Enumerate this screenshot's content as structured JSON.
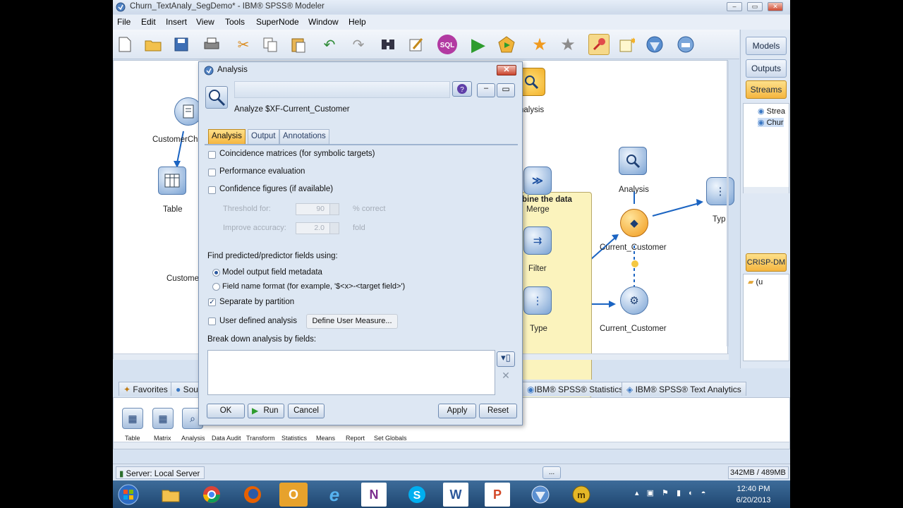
{
  "window": {
    "title": "Churn_TextAnaly_SegDemo* - IBM® SPSS® Modeler"
  },
  "menu": [
    "File",
    "Edit",
    "Insert",
    "View",
    "Tools",
    "SuperNode",
    "Window",
    "Help"
  ],
  "toolbar_icons": [
    "new-icon",
    "open-icon",
    "save-icon",
    "print-icon",
    "cut-icon",
    "copy-icon",
    "paste-icon",
    "undo-icon",
    "redo-icon",
    "find-icon",
    "edit-icon",
    "sql-icon",
    "run-icon",
    "run-selection-icon",
    "favorite-icon",
    "star-icon",
    "pin-icon",
    "annotate-icon",
    "model-icon",
    "cloud-icon"
  ],
  "toolbar_sql": "SQL",
  "right_panel": {
    "buttons": [
      "Models",
      "Outputs",
      "Streams"
    ],
    "stream_items": [
      "Strea",
      "Chur"
    ],
    "crisp": "CRISP-DM",
    "crisp_folder": "(u"
  },
  "canvas": {
    "nodes": [
      "CustomerCh",
      "Table",
      "Custome",
      "Merge",
      "Filter",
      "Type",
      "Analysis",
      "Current_Customer",
      "Current_Customer",
      "Typ",
      "nalysis"
    ],
    "supernode_label": "bine the data"
  },
  "palette_tabs": [
    "Favorites",
    "Sou",
    "IBM® SPSS® Statistics",
    "IBM® SPSS® Text Analytics"
  ],
  "palette_nodes": [
    "Table",
    "Matrix",
    "Analysis",
    "Data Audit",
    "Transform",
    "Statistics",
    "Means",
    "Report",
    "Set Globals"
  ],
  "status": {
    "server": "Server: Local Server",
    "memory": "342MB / 489MB",
    "dots": "..."
  },
  "taskbar": {
    "time": "12:40 PM",
    "date": "6/20/2013",
    "apps": [
      "windows-icon",
      "explorer-icon",
      "chrome-icon",
      "firefox-icon",
      "outlook-icon",
      "ie-icon",
      "onenote-icon",
      "skype-icon",
      "word-icon",
      "powerpoint-icon",
      "spss-icon",
      "app-icon"
    ]
  },
  "dialog": {
    "title": "Analysis",
    "subtitle": "Analyze  $XF-Current_Customer",
    "tabs": [
      "Analysis",
      "Output",
      "Annotations"
    ],
    "active_tab": "Analysis",
    "options": {
      "coincidence": "Coincidence matrices (for symbolic targets)",
      "performance": "Performance evaluation",
      "confidence": "Confidence figures (if available)",
      "threshold_label": "Threshold for:",
      "threshold_value": "90",
      "threshold_unit": "% correct",
      "improve_label": "Improve accuracy:",
      "improve_value": "2.0",
      "improve_unit": "fold",
      "find_label": "Find predicted/predictor fields using:",
      "radio_metadata": "Model output field metadata",
      "radio_format": "Field name format (for example, '$<x>-<target field>')",
      "separate": "Separate by partition",
      "user_defined": "User defined analysis",
      "define_button": "Define User Measure...",
      "breakdown_label": "Break down analysis by fields:"
    },
    "buttons": {
      "ok": "OK",
      "run": "Run",
      "cancel": "Cancel",
      "apply": "Apply",
      "reset": "Reset"
    }
  }
}
